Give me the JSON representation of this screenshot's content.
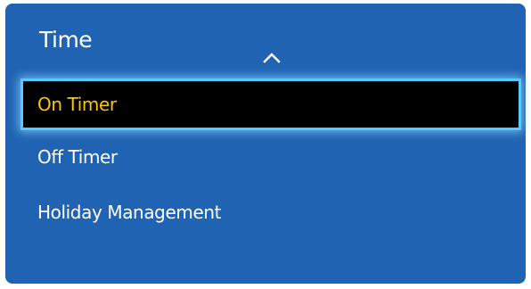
{
  "menu": {
    "title": "Time",
    "scroll_up_icon": "chevron-up-icon",
    "items": [
      {
        "label": "On Timer",
        "selected": true
      },
      {
        "label": "Off Timer",
        "selected": false
      },
      {
        "label": "Holiday Management",
        "selected": false
      }
    ]
  },
  "colors": {
    "panel_background": "#2163b3",
    "selected_background": "#000000",
    "selected_text": "#ffc400",
    "selection_border": "#5ac8ff",
    "text": "#ffffff"
  }
}
